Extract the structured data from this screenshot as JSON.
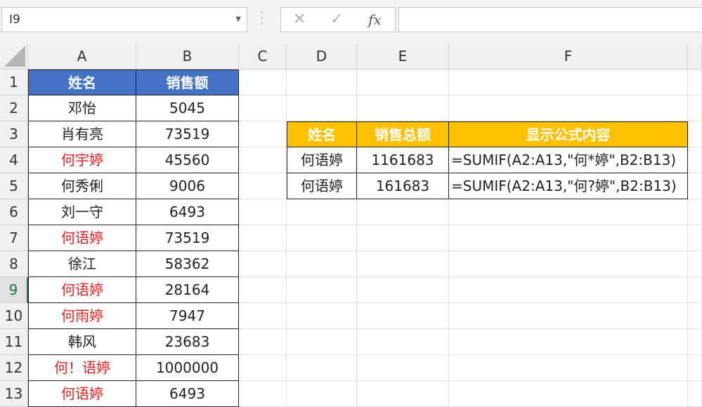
{
  "namebox": {
    "value": "I9"
  },
  "formula_bar": {
    "cancel_icon": "✕",
    "enter_icon": "✓",
    "fx_label": "fx",
    "content": ""
  },
  "columns": [
    "A",
    "B",
    "C",
    "D",
    "E",
    "F"
  ],
  "rows": [
    "1",
    "2",
    "3",
    "4",
    "5",
    "6",
    "7",
    "8",
    "9",
    "10",
    "11",
    "12",
    "13"
  ],
  "active_row": "9",
  "table1": {
    "headers": [
      "姓名",
      "销售额"
    ],
    "rows": [
      {
        "name": "邓怡",
        "value": "5045",
        "highlight": false
      },
      {
        "name": "肖有亮",
        "value": "73519",
        "highlight": false
      },
      {
        "name": "何宇婷",
        "value": "45560",
        "highlight": true
      },
      {
        "name": "何秀俐",
        "value": "9006",
        "highlight": false
      },
      {
        "name": "刘一守",
        "value": "6493",
        "highlight": false
      },
      {
        "name": "何语婷",
        "value": "73519",
        "highlight": true
      },
      {
        "name": "徐江",
        "value": "58362",
        "highlight": false
      },
      {
        "name": "何语婷",
        "value": "28164",
        "highlight": true
      },
      {
        "name": "何雨婷",
        "value": "7947",
        "highlight": true
      },
      {
        "name": "韩风",
        "value": "23683",
        "highlight": false
      },
      {
        "name": "何！语婷",
        "value": "1000000",
        "highlight": true
      },
      {
        "name": "何语婷",
        "value": "6493",
        "highlight": true
      }
    ],
    "colors": {
      "header_bg": "#4472c4",
      "highlight_text": "#e02020"
    }
  },
  "table2": {
    "headers": [
      "姓名",
      "销售总额",
      "显示公式内容"
    ],
    "rows": [
      {
        "name": "何语婷",
        "total": "1161683",
        "formula": "=SUMIF(A2:A13,\"何*婷\",B2:B13)"
      },
      {
        "name": "何语婷",
        "total": "161683",
        "formula": "=SUMIF(A2:A13,\"何?婷\",B2:B13)"
      }
    ],
    "colors": {
      "header_bg": "#ffc000"
    }
  }
}
